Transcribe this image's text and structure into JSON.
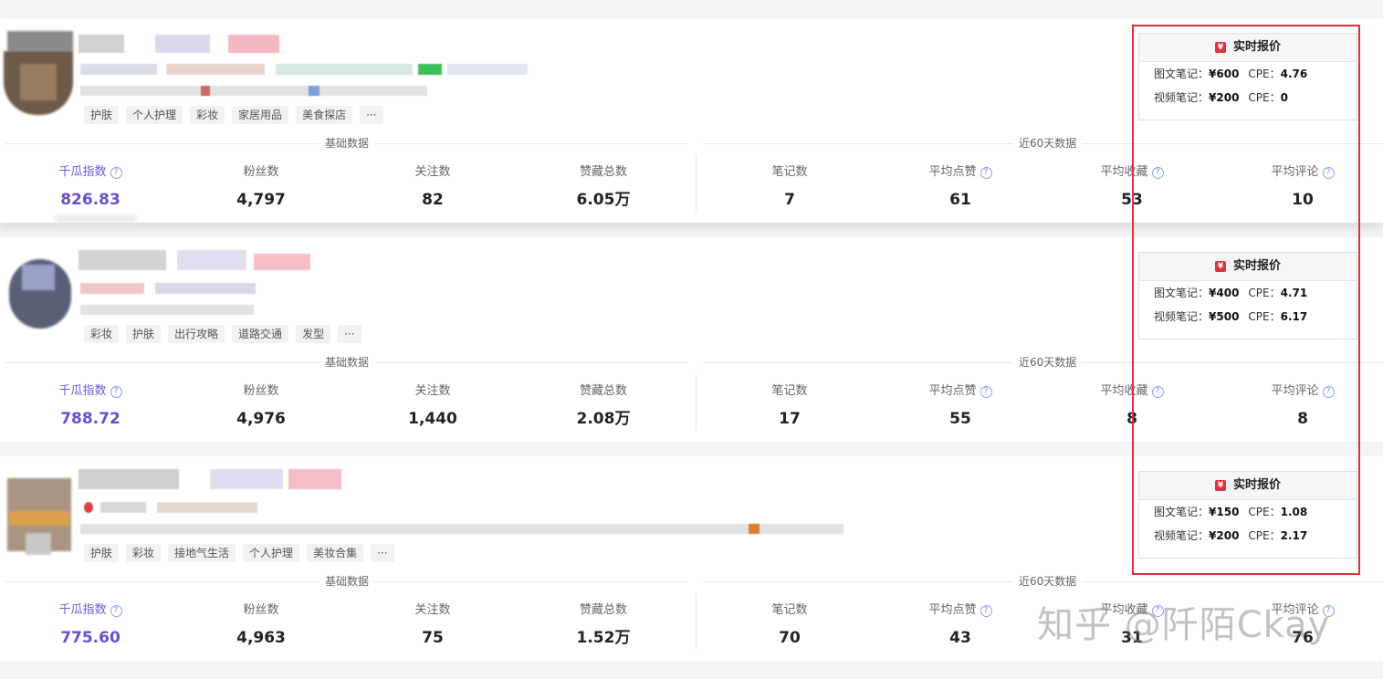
{
  "sections": {
    "basic": "基础数据",
    "recent": "近60天数据"
  },
  "metric_labels": [
    "千瓜指数",
    "粉丝数",
    "关注数",
    "赞藏总数",
    "笔记数",
    "平均点赞",
    "平均收藏",
    "平均评论"
  ],
  "quote": {
    "title": "实时报价",
    "image_label": "图文笔记：",
    "video_label": "视频笔记：",
    "cpe_label": "CPE：",
    "yen_symbol": "¥"
  },
  "cards": [
    {
      "tags": [
        "护肤",
        "个人护理",
        "彩妆",
        "家居用品",
        "美食探店",
        "···"
      ],
      "metrics": [
        "826.83",
        "4,797",
        "82",
        "6.05万",
        "7",
        "61",
        "53",
        "10"
      ],
      "quote": {
        "image_price": "¥600",
        "image_cpe": "4.76",
        "video_price": "¥200",
        "video_cpe": "0"
      }
    },
    {
      "tags": [
        "彩妆",
        "护肤",
        "出行攻略",
        "道路交通",
        "发型",
        "···"
      ],
      "metrics": [
        "788.72",
        "4,976",
        "1,440",
        "2.08万",
        "17",
        "55",
        "8",
        "8"
      ],
      "quote": {
        "image_price": "¥400",
        "image_cpe": "4.71",
        "video_price": "¥500",
        "video_cpe": "6.17"
      }
    },
    {
      "tags": [
        "护肤",
        "彩妆",
        "接地气生活",
        "个人护理",
        "美妆合集",
        "···"
      ],
      "metrics": [
        "775.60",
        "4,963",
        "75",
        "1.52万",
        "70",
        "43",
        "31",
        "76"
      ],
      "quote": {
        "image_price": "¥150",
        "image_cpe": "1.08",
        "video_price": "¥200",
        "video_cpe": "2.17"
      }
    }
  ],
  "watermark": "知乎 @阡陌Ckay",
  "colors": {
    "accent_purple": "#6a4fcf",
    "highlight_red": "#e0313a",
    "yen_badge": "#e0333f"
  }
}
